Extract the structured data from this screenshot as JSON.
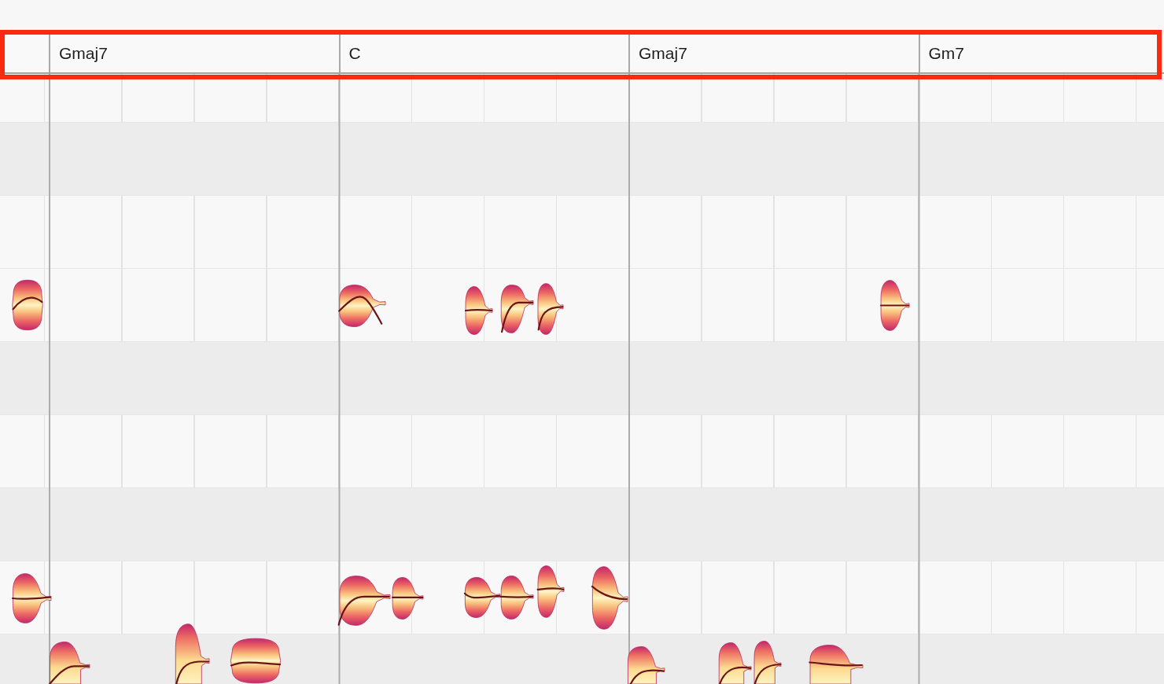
{
  "chord_track": {
    "highlighted": true,
    "chords": [
      {
        "label": "Gmaj7"
      },
      {
        "label": "C"
      },
      {
        "label": "Gmaj7"
      },
      {
        "label": "Gm7"
      }
    ]
  },
  "pitch_rows": [
    {
      "kind": "white"
    },
    {
      "kind": "black"
    },
    {
      "kind": "white"
    },
    {
      "kind": "white"
    },
    {
      "kind": "black"
    },
    {
      "kind": "white"
    },
    {
      "kind": "black"
    },
    {
      "kind": "white"
    },
    {
      "kind": "black"
    }
  ]
}
